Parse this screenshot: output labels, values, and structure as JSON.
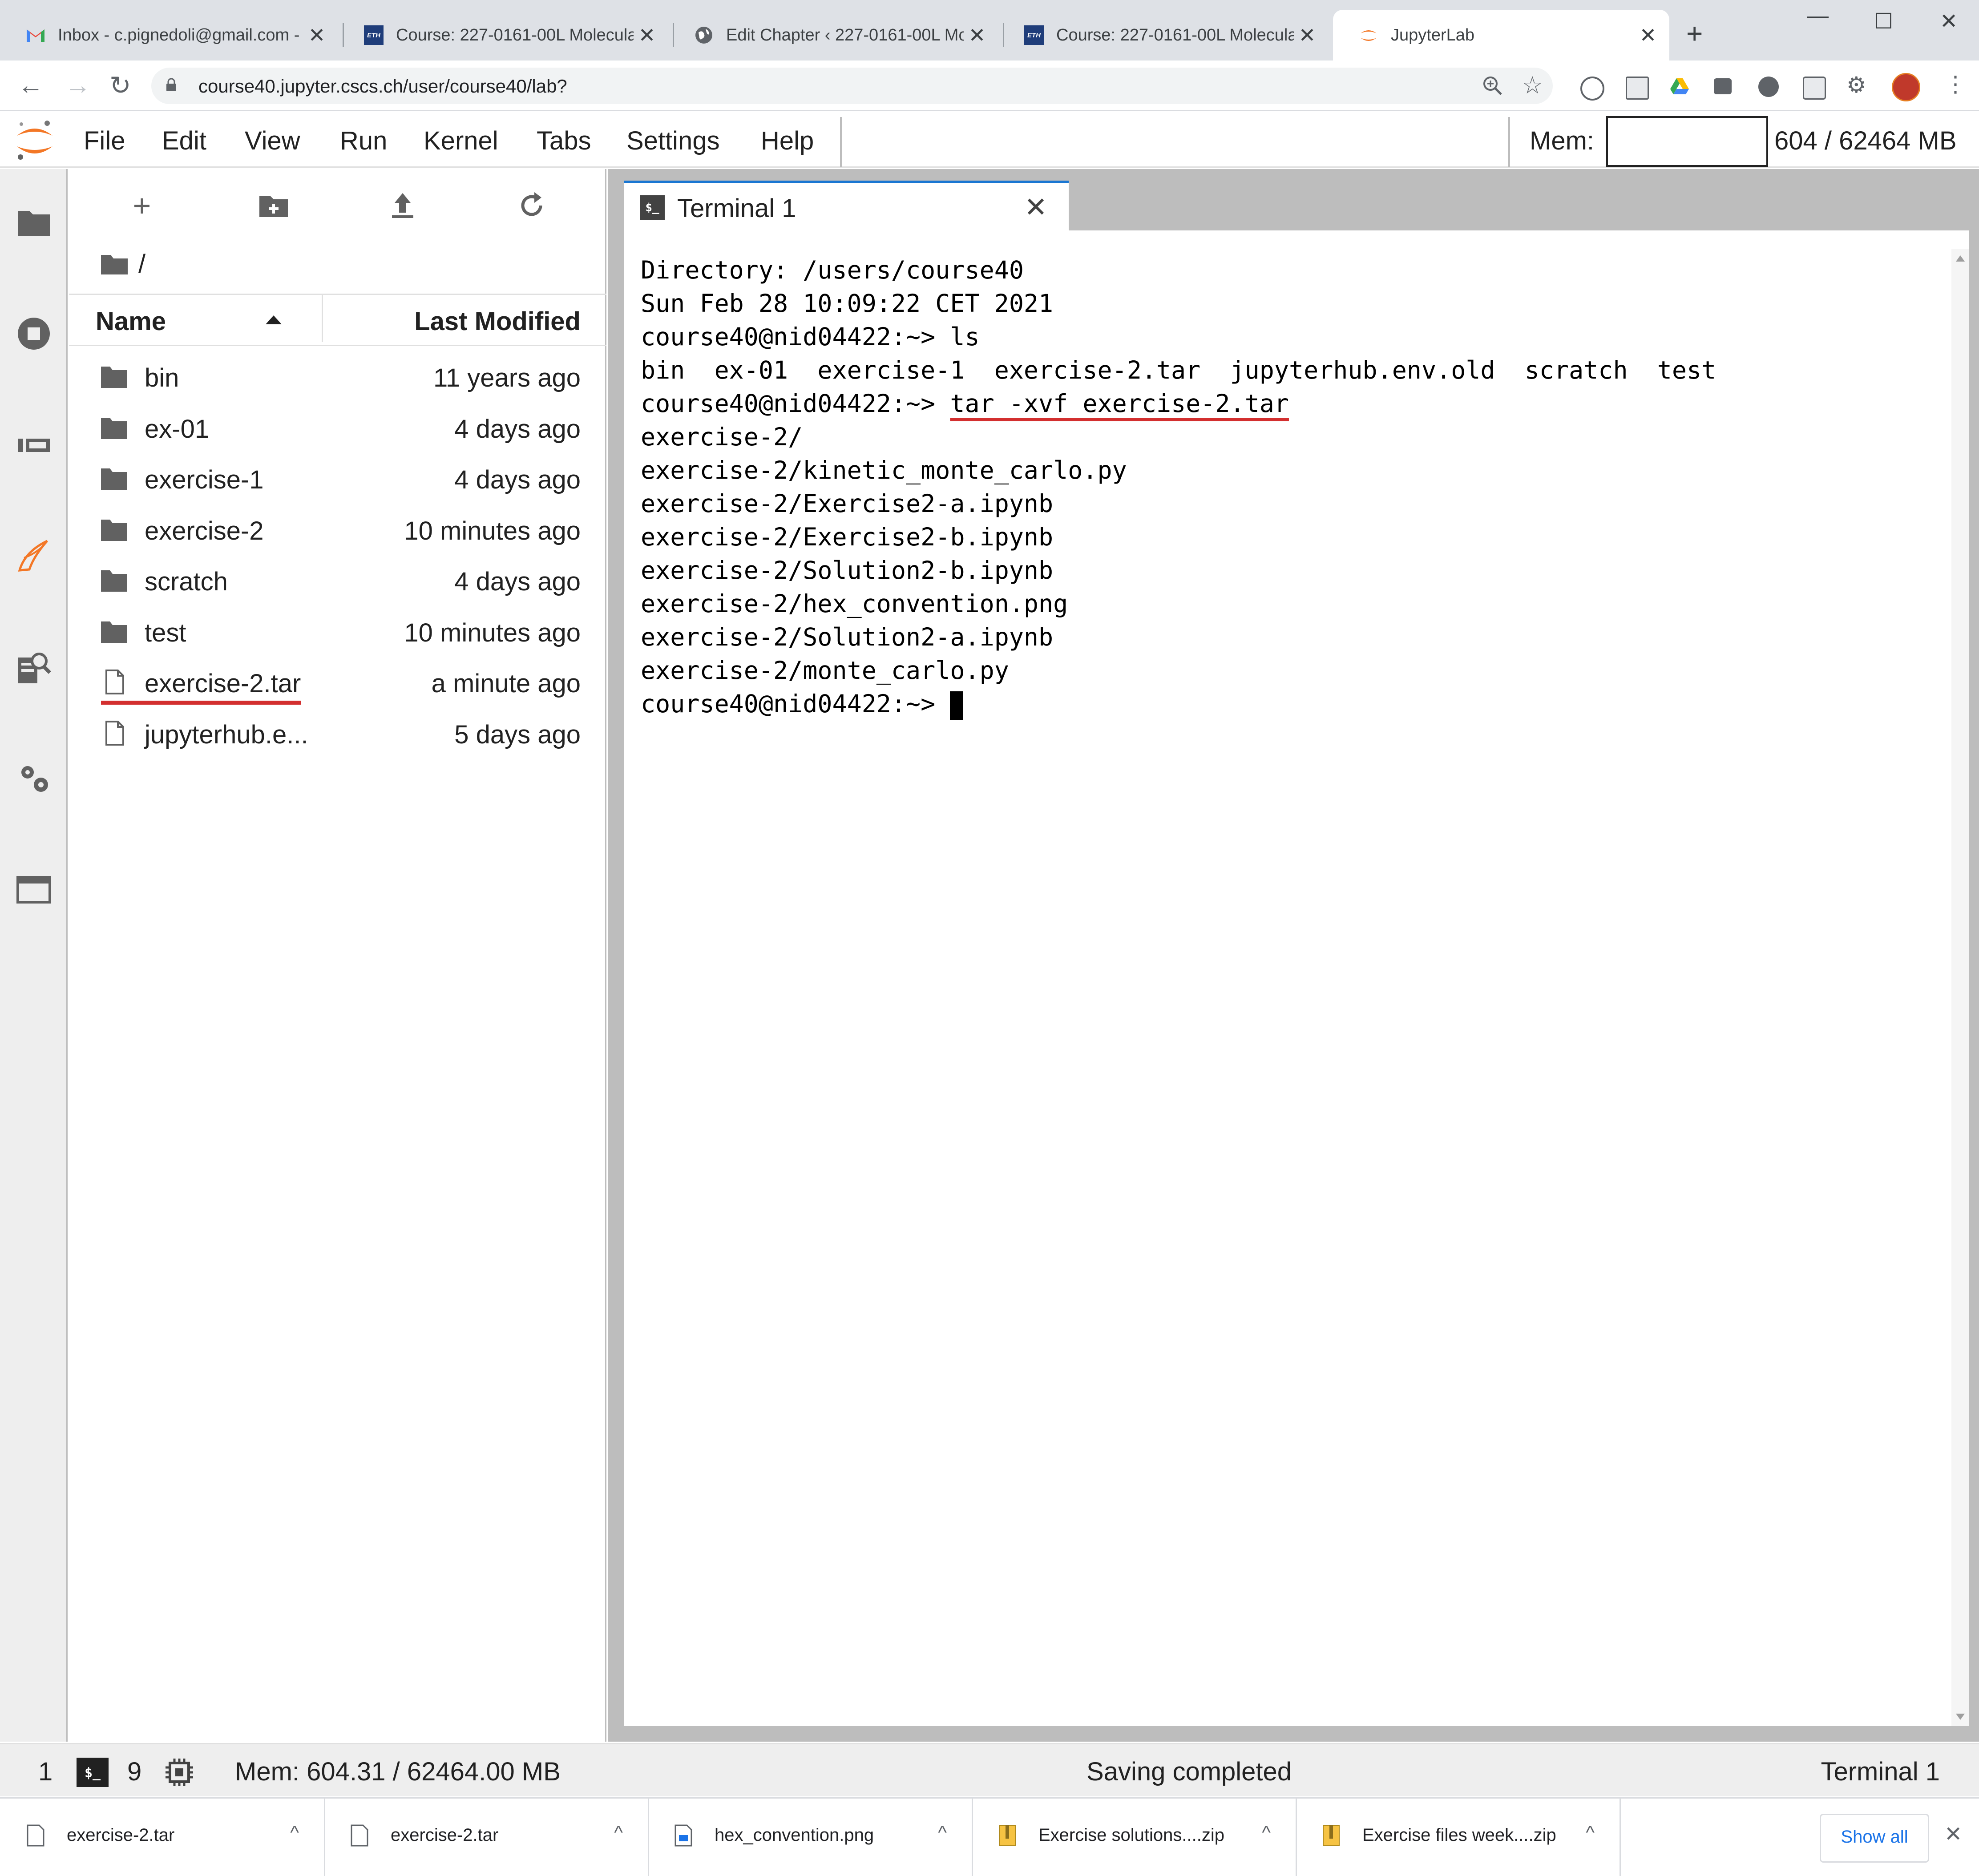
{
  "browser": {
    "tabs": [
      {
        "title": "Inbox - c.pignedoli@gmail.com -",
        "icon": "gmail-icon"
      },
      {
        "title": "Course: 227-0161-00L Molecular",
        "icon": "eth-icon"
      },
      {
        "title": "Edit Chapter ‹ 227-0161-00L Mol",
        "icon": "globe-icon"
      },
      {
        "title": "Course: 227-0161-00L Molecular",
        "icon": "eth-icon"
      },
      {
        "title": "JupyterLab",
        "icon": "jupyter-icon"
      }
    ],
    "eth_label": "ETH",
    "url": "course40.jupyter.cscs.ch/user/course40/lab?",
    "new_tab": "+",
    "close_glyph": "✕"
  },
  "jupyter": {
    "menu": [
      "File",
      "Edit",
      "View",
      "Run",
      "Kernel",
      "Tabs",
      "Settings",
      "Help"
    ],
    "mem_label": "Mem:",
    "mem_value": "604 / 62464 MB"
  },
  "filebrowser": {
    "breadcrumb": "/",
    "col_name": "Name",
    "col_modified": "Last Modified",
    "items": [
      {
        "name": "bin",
        "modified": "11 years ago",
        "type": "folder"
      },
      {
        "name": "ex-01",
        "modified": "4 days ago",
        "type": "folder"
      },
      {
        "name": "exercise-1",
        "modified": "4 days ago",
        "type": "folder"
      },
      {
        "name": "exercise-2",
        "modified": "10 minutes ago",
        "type": "folder"
      },
      {
        "name": "scratch",
        "modified": "4 days ago",
        "type": "folder"
      },
      {
        "name": "test",
        "modified": "10 minutes ago",
        "type": "folder"
      },
      {
        "name": "exercise-2.tar",
        "modified": "a minute ago",
        "type": "file",
        "underlined": true
      },
      {
        "name": "jupyterhub.e...",
        "modified": "5 days ago",
        "type": "file"
      }
    ]
  },
  "terminal": {
    "tab_title": "Terminal 1",
    "tab_icon_text": "$_",
    "lines": [
      "Directory: /users/course40",
      "Sun Feb 28 10:09:22 CET 2021",
      "course40@nid04422:~> ls",
      "bin  ex-01  exercise-1  exercise-2.tar  jupyterhub.env.old  scratch  test"
    ],
    "cmd_prompt": "course40@nid04422:~> ",
    "cmd_text": "tar -xvf exercise-2.tar",
    "output": [
      "exercise-2/",
      "exercise-2/kinetic_monte_carlo.py",
      "exercise-2/Exercise2-a.ipynb",
      "exercise-2/Exercise2-b.ipynb",
      "exercise-2/Solution2-b.ipynb",
      "exercise-2/hex_convention.png",
      "exercise-2/Solution2-a.ipynb",
      "exercise-2/monte_carlo.py"
    ],
    "final_prompt": "course40@nid04422:~> "
  },
  "statusbar": {
    "count1": "1",
    "terminal_icon_text": "$_",
    "count2": "9",
    "mem": "Mem: 604.31 / 62464.00 MB",
    "message": "Saving completed",
    "active": "Terminal 1"
  },
  "downloads": {
    "items": [
      {
        "name": "exercise-2.tar",
        "icon": "file-icon"
      },
      {
        "name": "exercise-2.tar",
        "icon": "file-icon"
      },
      {
        "name": "hex_convention.png",
        "icon": "image-file-icon"
      },
      {
        "name": "Exercise solutions....zip",
        "icon": "zip-icon"
      },
      {
        "name": "Exercise files week....zip",
        "icon": "zip-icon"
      }
    ],
    "show_all": "Show all",
    "chevron": "^"
  },
  "colors": {
    "accent_blue": "#1976d2",
    "underline_red": "#d32f2f",
    "jupyter_orange": "#f37726"
  }
}
